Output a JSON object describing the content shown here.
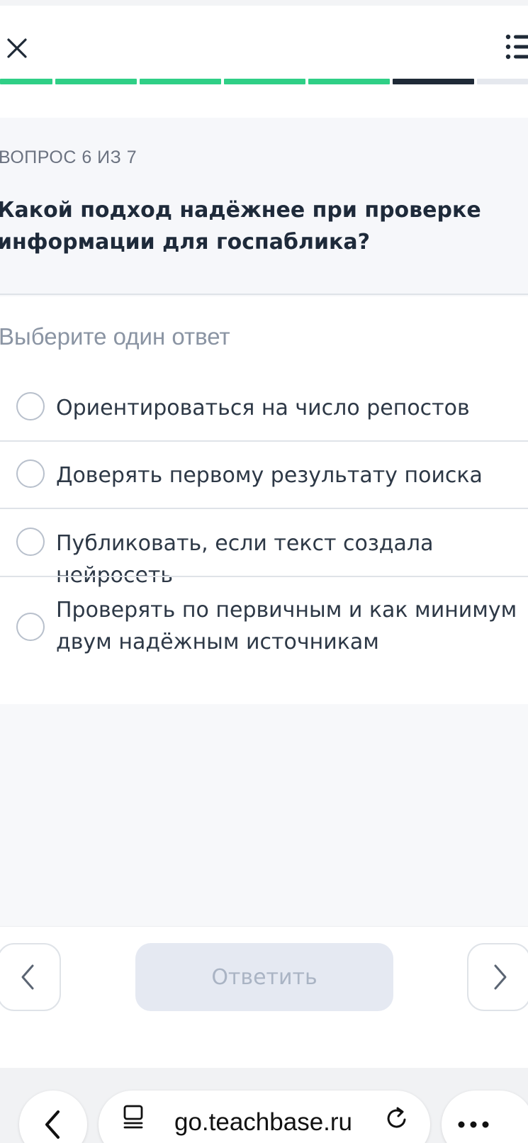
{
  "header": {
    "close_icon": "close-icon",
    "menu_icon": "list-icon",
    "progress": {
      "total": 7,
      "current": 6,
      "completed_color": "#2fcf86",
      "current_color": "#1f2a37",
      "pending_color": "#e5e8ee"
    }
  },
  "question": {
    "counter": "ВОПРОС 6 ИЗ 7",
    "text": "Какой подход надёжнее при проверке информации для госпаблика?"
  },
  "answers": {
    "hint": "Выберите один ответ",
    "options": [
      {
        "label": "Ориентироваться на число репостов",
        "selected": false
      },
      {
        "label": "Доверять первому результату поиска",
        "selected": false
      },
      {
        "label": "Публиковать, если текст создала нейросеть",
        "selected": false
      },
      {
        "label": "Проверять по первичным и как минимум двум надёжным источникам",
        "selected": false
      }
    ]
  },
  "footer": {
    "prev_icon": "chevron-left-icon",
    "next_icon": "chevron-right-icon",
    "submit_label": "Ответить"
  },
  "browser": {
    "back_icon": "chevron-left-icon",
    "tabs_icon": "page-icon",
    "url": "go.teachbase.ru",
    "reload_icon": "reload-icon",
    "more_icon": "more-icon"
  }
}
